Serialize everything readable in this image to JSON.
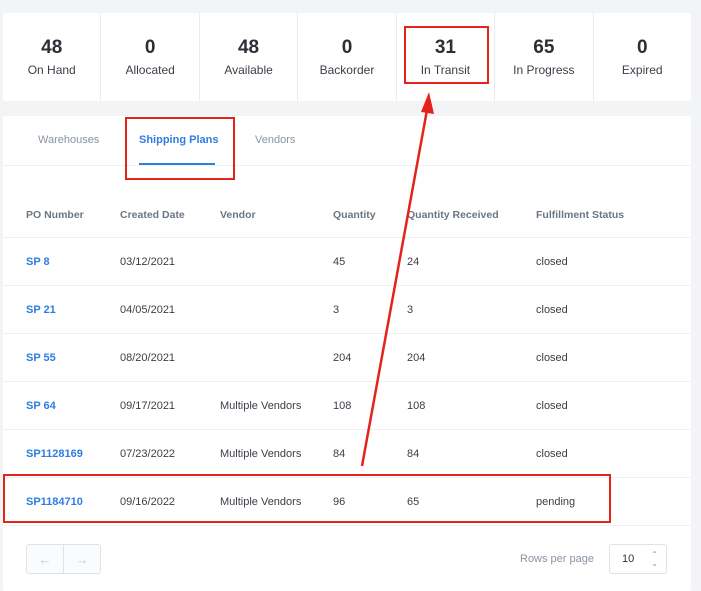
{
  "stats": [
    {
      "value": "48",
      "label": "On Hand"
    },
    {
      "value": "0",
      "label": "Allocated"
    },
    {
      "value": "48",
      "label": "Available"
    },
    {
      "value": "0",
      "label": "Backorder"
    },
    {
      "value": "31",
      "label": "In Transit"
    },
    {
      "value": "65",
      "label": "In Progress"
    },
    {
      "value": "0",
      "label": "Expired"
    }
  ],
  "tabs": [
    "Warehouses",
    "Shipping Plans",
    "Vendors"
  ],
  "columns": [
    "PO Number",
    "Created Date",
    "Vendor",
    "Quantity",
    "Quantity Received",
    "Fulfillment Status"
  ],
  "rows": [
    {
      "po": "SP 8",
      "date": "03/12/2021",
      "vendor": "",
      "qty": "45",
      "received": "24",
      "status": "closed"
    },
    {
      "po": "SP 21",
      "date": "04/05/2021",
      "vendor": "",
      "qty": "3",
      "received": "3",
      "status": "closed"
    },
    {
      "po": "SP 55",
      "date": "08/20/2021",
      "vendor": "",
      "qty": "204",
      "received": "204",
      "status": "closed"
    },
    {
      "po": "SP 64",
      "date": "09/17/2021",
      "vendor": "Multiple Vendors",
      "qty": "108",
      "received": "108",
      "status": "closed"
    },
    {
      "po": "SP1128169",
      "date": "07/23/2022",
      "vendor": "Multiple Vendors",
      "qty": "84",
      "received": "84",
      "status": "closed"
    },
    {
      "po": "SP1184710",
      "date": "09/16/2022",
      "vendor": "Multiple Vendors",
      "qty": "96",
      "received": "65",
      "status": "pending"
    }
  ],
  "pagination": {
    "prev_icon": "←",
    "next_icon": "→",
    "rows_per_page_label": "Rows per page",
    "rows_per_page": "10",
    "stepper_icon": "⌃⌄"
  },
  "annotation_color": "#e4231b",
  "accent_color": "#2f7de1"
}
